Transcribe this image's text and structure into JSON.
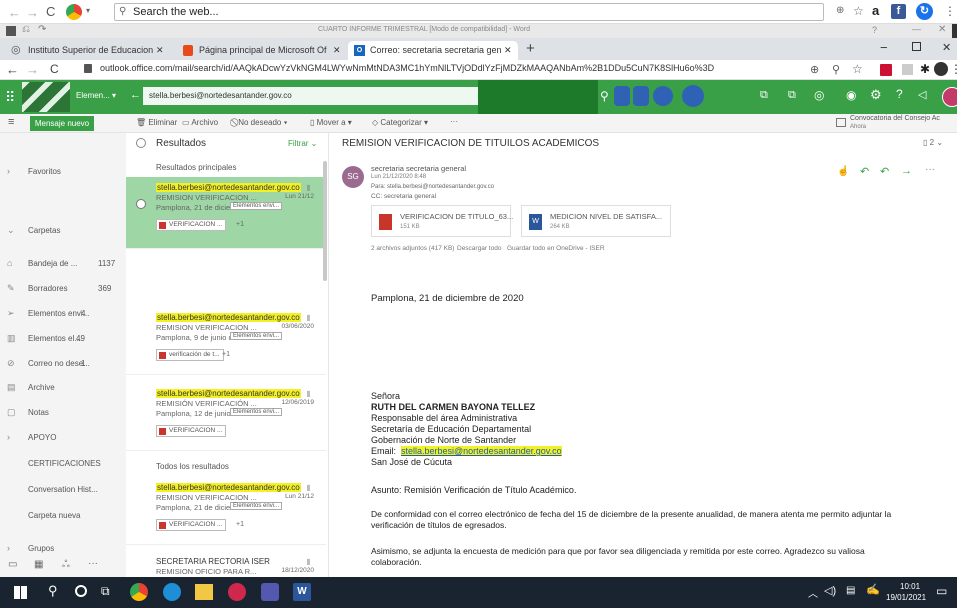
{
  "outer_browser": {
    "search_text": "Search the web..."
  },
  "word_titlebar": {
    "title": "CUARTO INFORME TRIMESTRAL [Modo de compatibilidad] - Word"
  },
  "tabs": [
    {
      "label": "Instituto Superior de Educacion"
    },
    {
      "label": "Página principal de Microsoft Of"
    },
    {
      "label": "Correo: secretaria secretaria gen"
    }
  ],
  "address_bar": {
    "url": "outlook.office.com/mail/search/id/AAQkADcwYzVkNGM4LWYwNmMtNDA3MC1hYmNlLTVjODdlYzFjMDZkMAAQANbAm%2B1DDu5CuN7K8SlHu6o%3D"
  },
  "outlook_header": {
    "app_name": "Elemen...",
    "account": "stella.berbesi@nortedesantander.gov.co"
  },
  "command_bar": {
    "new_message": "Mensaje nuevo",
    "delete": "Eliminar",
    "archive": "Archivo",
    "junk": "No deseado",
    "move": "Mover a",
    "categorize": "Categorizar",
    "notice": "Convocatoria del Consejo Ac",
    "notice_sub": "Ahora"
  },
  "nav": {
    "favorites": "Favoritos",
    "folders": "Carpetas",
    "items": [
      {
        "label": "Bandeja de ...",
        "count": "1137"
      },
      {
        "label": "Borradores",
        "count": "369"
      },
      {
        "label": "Elementos envi...",
        "count": "4"
      },
      {
        "label": "Elementos el...",
        "count": "49"
      },
      {
        "label": "Correo no dese...",
        "count": "1"
      },
      {
        "label": "Archive",
        "count": ""
      },
      {
        "label": "Notas",
        "count": ""
      },
      {
        "label": "APOYO",
        "count": ""
      },
      {
        "label": "CERTIFICACIONES",
        "count": ""
      },
      {
        "label": "Conversation Hist...",
        "count": ""
      },
      {
        "label": "Carpeta nueva",
        "count": ""
      },
      {
        "label": "Grupos",
        "count": ""
      }
    ]
  },
  "message_list": {
    "title": "Resultados",
    "filter": "Filtrar",
    "top_results": "Resultados principales",
    "all_results": "Todos los resultados",
    "messages": [
      {
        "sender": "stella.berbesi@nortedesantander.gov.co",
        "subject": "REMISION VERIFICACION ...",
        "date": "Lun 21/12",
        "preview": "Pamplona, 21 de dicie...",
        "tag": "Elementos envi...",
        "attachment": "VERIFICACION ...",
        "extra": "+1"
      },
      {
        "sender": "stella.berbesi@nortedesantander.gov.co",
        "subject": "REMISION VERIFICACION ...",
        "date": "03/06/2020",
        "preview": "Pamplona, 9 de junio d...",
        "tag": "Elementos envi...",
        "attachment": "verificación de t...",
        "extra": "+1"
      },
      {
        "sender": "stella.berbesi@nortedesantander.gov.co",
        "subject": "REMISIÓN VERIFICACIÓN ...",
        "date": "12/06/2019",
        "preview": "Pamplona, 12 de junio ...",
        "tag": "Elementos envi...",
        "attachment": "VERIFICACION ...",
        "extra": ""
      },
      {
        "sender": "stella.berbesi@nortedesantander.gov.co",
        "subject": "REMISION VERIFICACION ...",
        "date": "Lun 21/12",
        "preview": "Pamplona, 21 de dicie...",
        "tag": "Elementos envi...",
        "attachment": "VERIFICACION ...",
        "extra": "+1"
      },
      {
        "sender": "SECRETARIA RECTORIA ISER",
        "subject": "REMISION OFICIO PARA R...",
        "date": "18/12/2020",
        "preview": "",
        "tag": "",
        "attachment": "",
        "extra": ""
      }
    ]
  },
  "reading": {
    "subject": "REMISION VERIFICACION DE TITUILOS ACADEMICOS",
    "count": "2",
    "avatar": "SG",
    "from": "secretaria secretaria general",
    "date": "Lun 21/12/2020 8:48",
    "to": "Para: stella.berbesi@nortedesantander.gov.co",
    "cc": "CC: secretaria general",
    "attachments": [
      {
        "name": "VERIFICACION DE TITULO_63...",
        "size": "151 KB"
      },
      {
        "name": "MEDICION NIVEL DE SATISFA...",
        "size": "264 KB"
      }
    ],
    "attach_summary": "2 archivos adjuntos (417 KB)",
    "download_all": "Descargar todo",
    "save_all": "Guardar todo en OneDrive - ISER",
    "body": {
      "date_line": "Pamplona, 21 de diciembre de 2020",
      "salutation": "Señora",
      "name": "RUTH DEL CARMEN BAYONA TELLEZ",
      "role1": "Responsable del área Administrativa",
      "role2": "Secretaría de Educación Departamental",
      "role3": "Gobernación de Norte de Santander",
      "email_label": "Email:",
      "email": "stella.berbesi@nortedesantander.gov.co",
      "city": "San José de Cúcuta",
      "asunto": "Asunto: Remisión Verificación de Título Académico.",
      "para1": "De conformidad con el correo electrónico de fecha del 15 de diciembre de la presente anualidad, de manera atenta me permito adjuntar la",
      "para1b": "verificación de títulos de egresados.",
      "para2": "Asimismo, se adjunta la encuesta de medición para que por favor sea diligenciada y remitida por este correo.  Agradezco su valiosa",
      "para2b": "colaboración."
    }
  },
  "taskbar": {
    "time": "10:01",
    "date": "19/01/2021"
  }
}
